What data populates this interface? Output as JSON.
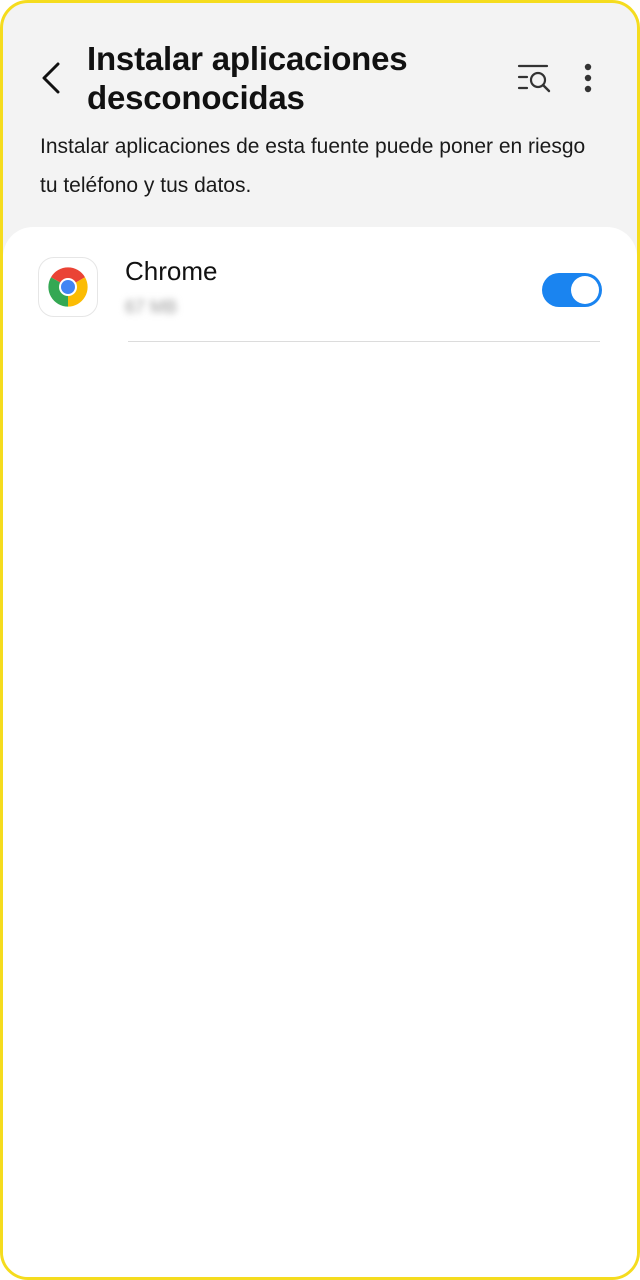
{
  "header": {
    "title": "Instalar aplicaciones desconocidas",
    "description": "Instalar aplicaciones de esta fuente puede poner en riesgo tu teléfono y tus datos.",
    "back_icon": "chevron-left-icon",
    "search_icon": "search-list-icon",
    "more_icon": "more-vertical-icon"
  },
  "apps": [
    {
      "name": "Chrome",
      "size": "67 MB",
      "icon": "chrome-icon",
      "allowed": true
    }
  ],
  "colors": {
    "header_background": "#f3f3f3",
    "card_background": "#ffffff",
    "toggle_on": "#1a84f0",
    "frame_border": "#f5dc1e"
  }
}
